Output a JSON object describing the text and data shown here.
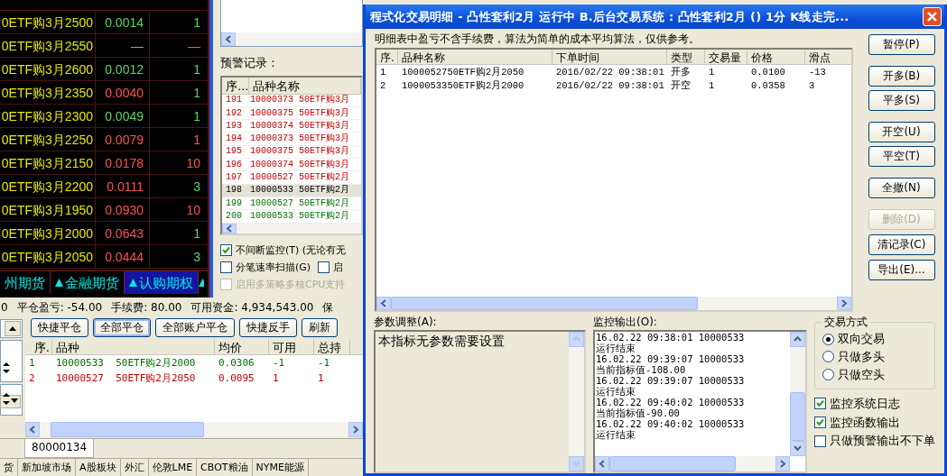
{
  "quote_table": {
    "rows": [
      {
        "name": "0ETF购3月2500",
        "price": {
          "text": "0.0014",
          "color": "#5fd35f"
        },
        "volume": {
          "text": "1",
          "color": "#5fd35f"
        }
      },
      {
        "name": "0ETF购3月2550",
        "price": {
          "text": "—",
          "color": "#5fd35f"
        },
        "volume": {
          "text": "—",
          "color": "#ff5050"
        }
      },
      {
        "name": "0ETF购3月2600",
        "price": {
          "text": "0.0012",
          "color": "#5fd35f"
        },
        "volume": {
          "text": "1",
          "color": "#5fd35f"
        }
      },
      {
        "name": "0ETF购3月2350",
        "price": {
          "text": "0.0040",
          "color": "#ff5050"
        },
        "volume": {
          "text": "1",
          "color": "#5fd35f"
        }
      },
      {
        "name": "0ETF购3月2300",
        "price": {
          "text": "0.0049",
          "color": "#5fd35f"
        },
        "volume": {
          "text": "1",
          "color": "#5fd35f"
        }
      },
      {
        "name": "0ETF购3月2250",
        "price": {
          "text": "0.0079",
          "color": "#ff5050"
        },
        "volume": {
          "text": "1",
          "color": "#ff5050"
        }
      },
      {
        "name": "0ETF购3月2150",
        "price": {
          "text": "0.0178",
          "color": "#ff5050"
        },
        "volume": {
          "text": "10",
          "color": "#ff5050"
        }
      },
      {
        "name": "0ETF购3月2200",
        "price": {
          "text": "0.0111",
          "color": "#ff5050"
        },
        "volume": {
          "text": "3",
          "color": "#5fd35f"
        }
      },
      {
        "name": "0ETF购3月1950",
        "price": {
          "text": "0.0930",
          "color": "#ff5050"
        },
        "volume": {
          "text": "10",
          "color": "#ff5050"
        }
      },
      {
        "name": "0ETF购3月2000",
        "price": {
          "text": "0.0643",
          "color": "#ff5050"
        },
        "volume": {
          "text": "1",
          "color": "#5fd35f"
        }
      },
      {
        "name": "0ETF购3月2050",
        "price": {
          "text": "0.0444",
          "color": "#ff5050"
        },
        "volume": {
          "text": "3",
          "color": "#5fd35f"
        }
      }
    ]
  },
  "market_tabs": [
    {
      "label": "州期货",
      "selected": false
    },
    {
      "label": "金融期货",
      "selected": false
    },
    {
      "label": "认购期权",
      "selected": true
    }
  ],
  "alert_panel": {
    "title": "预警记录：",
    "columns": [
      "序...",
      "品种名称"
    ],
    "rows": [
      {
        "seq": "191",
        "name": "10000373 50ETF购3月",
        "color": "#c00000",
        "selected": false
      },
      {
        "seq": "192",
        "name": "10000375 50ETF购3月",
        "color": "#c00000",
        "selected": false
      },
      {
        "seq": "193",
        "name": "10000374 50ETF购3月",
        "color": "#c00000",
        "selected": false
      },
      {
        "seq": "194",
        "name": "10000373 50ETF购3月",
        "color": "#c00000",
        "selected": false
      },
      {
        "seq": "195",
        "name": "10000375 50ETF购3月",
        "color": "#c00000",
        "selected": false
      },
      {
        "seq": "196",
        "name": "10000374 50ETF购3月",
        "color": "#c00000",
        "selected": false
      },
      {
        "seq": "197",
        "name": "10000527 50ETF购2月",
        "color": "#c00000",
        "selected": false
      },
      {
        "seq": "198",
        "name": "10000533 50ETF购2月",
        "color": "#000000",
        "selected": true
      },
      {
        "seq": "199",
        "name": "10000527 50ETF购2月",
        "color": "#007000",
        "selected": false
      },
      {
        "seq": "200",
        "name": "10000533 50ETF购2月",
        "color": "#007000",
        "selected": false
      }
    ],
    "options": [
      {
        "label": "不间断监控(T) (无论有无",
        "checked": true,
        "disabled": false
      },
      {
        "label": "分笔速率扫描(G)",
        "checked": false,
        "disabled": false
      },
      {
        "label": "启",
        "checked": false,
        "disabled": false
      },
      {
        "label": "启用多策略多核CPU支持",
        "checked": false,
        "disabled": true
      }
    ]
  },
  "account_bar": [
    "0",
    "平仓盈亏: -54.00",
    "手续费: 80.00",
    "可用资金: 4,934,543.00",
    "保"
  ],
  "position_buttons": [
    {
      "label": "快捷平仓",
      "focused": false
    },
    {
      "label": "全部平仓",
      "focused": true
    },
    {
      "label": "全部账户平仓",
      "focused": false
    },
    {
      "label": "快捷反手",
      "focused": false
    },
    {
      "label": "刷新",
      "focused": false
    }
  ],
  "positions": {
    "columns": [
      "序.",
      "品种",
      "均价",
      "可用",
      "总持"
    ],
    "rows": [
      {
        "cells": [
          "1",
          "10000533  50ETF购2月2000",
          "0.0306",
          "-1",
          "-1"
        ],
        "color": "#007000"
      },
      {
        "cells": [
          "2",
          "10000527  50ETF购2月2050",
          "0.0095",
          "1",
          "1"
        ],
        "color": "#c00000"
      }
    ]
  },
  "account_tab": "80000134",
  "bottom_tabs": [
    "货",
    "新加坡市场",
    "A股板块",
    "外汇",
    "伦敦LME",
    "CBOT粮油",
    "NYME能源"
  ],
  "dialog": {
    "title": "程式化交易明细 - 凸性套利2月  运行中   B.后台交易系统 : 凸性套利2月 () 1分 K线走完...",
    "note": "明细表中盈亏不含手续费，算法为简单的成本平均算法，仅供参考。",
    "orders": {
      "columns": [
        "序.",
        "品种名称",
        "下单时间",
        "类型",
        "交易量",
        "价格",
        "滑点"
      ],
      "rows": [
        {
          "cells": [
            "1",
            "1000052750ETF购2月2050",
            "2016/02/22 09:38:01",
            "开多",
            "1",
            "0.0100",
            "-13"
          ]
        },
        {
          "cells": [
            "2",
            "1000053350ETF购2月2000",
            "2016/02/22 09:38:01",
            "开空",
            "1",
            "0.0358",
            "3"
          ]
        }
      ]
    },
    "button_groups": [
      [
        {
          "label": "暂停(P)",
          "disabled": false
        }
      ],
      [
        {
          "label": "开多(B)",
          "disabled": false
        },
        {
          "label": "平多(S)",
          "disabled": false
        }
      ],
      [
        {
          "label": "开空(U)",
          "disabled": false
        },
        {
          "label": "平空(T)",
          "disabled": false
        }
      ],
      [
        {
          "label": "全撤(N)",
          "disabled": false
        }
      ],
      [
        {
          "label": "删除(D)",
          "disabled": true
        },
        {
          "label": "清记录(C)",
          "disabled": false
        },
        {
          "label": "导出(E)...",
          "disabled": false
        }
      ]
    ],
    "params": {
      "label": "参数调整(A):",
      "text": "本指标无参数需要设置"
    },
    "monitor": {
      "label": "监控输出(O):",
      "lines": [
        "16.02.22 09:38:01 10000533",
        "运行结束",
        "16.02.22 09:39:07 10000533",
        "当前指标值-108.00",
        "16.02.22 09:39:07 10000533",
        "运行结束",
        "16.02.22 09:40:02 10000533",
        "当前指标值-90.00",
        "16.02.22 09:40:02 10000533",
        "运行结束"
      ]
    },
    "trade_mode": {
      "title": "交易方式",
      "options": [
        {
          "label": "双向交易",
          "selected": true
        },
        {
          "label": "只做多头",
          "selected": false
        },
        {
          "label": "只做空头",
          "selected": false
        }
      ]
    },
    "checks": [
      {
        "label": "监控系统日志",
        "checked": true
      },
      {
        "label": "监控函数输出",
        "checked": true
      },
      {
        "label": "只做预警输出不下单",
        "checked": false
      }
    ]
  }
}
